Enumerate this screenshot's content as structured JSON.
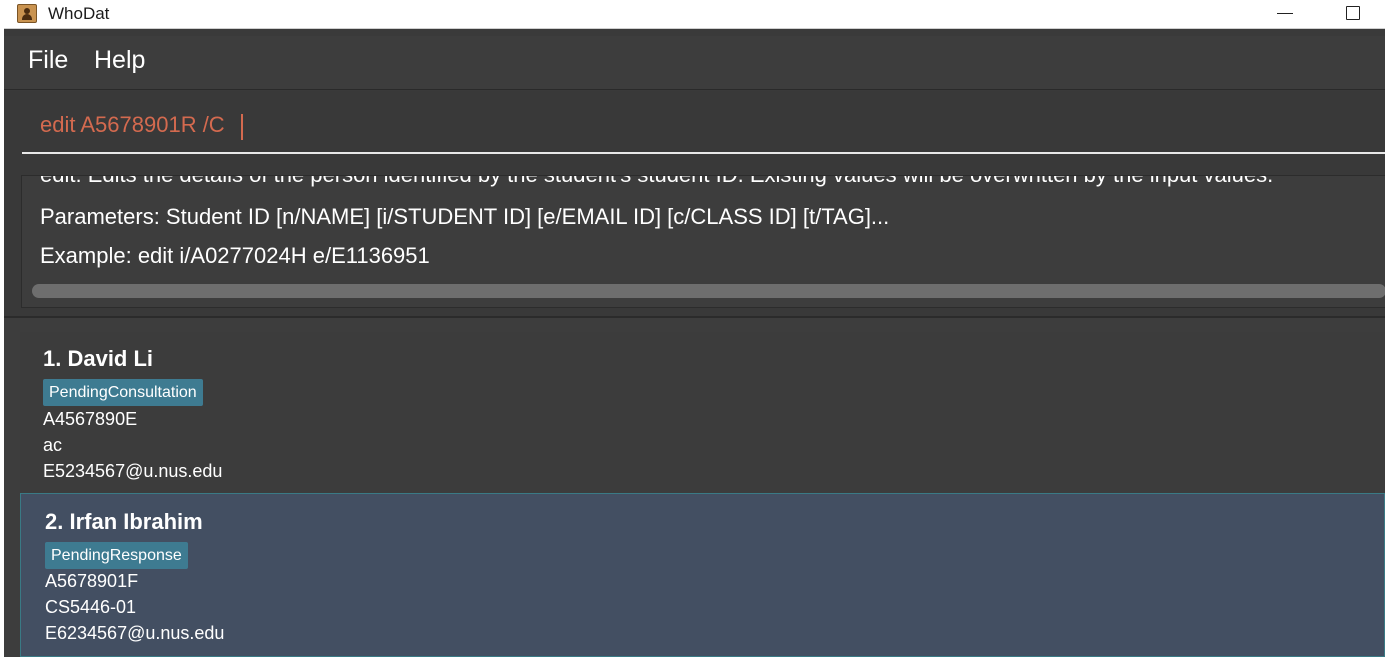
{
  "window": {
    "title": "WhoDat",
    "icon": "address-book-icon"
  },
  "menu": {
    "items": [
      "File",
      "Help"
    ]
  },
  "command_box": {
    "value": "edit A5678901R /C"
  },
  "result_display": {
    "lines": [
      "edit: Edits the details of the person identified by the student's student ID. Existing values will be overwritten by the input values.",
      "Parameters: Student ID [n/NAME] [i/STUDENT ID] [e/EMAIL ID] [c/CLASS ID] [t/TAG]...",
      "Example: edit i/A0277024H e/E1136951"
    ]
  },
  "persons": [
    {
      "name": "1. David Li",
      "tag": "PendingConsultation",
      "student_id": "A4567890E",
      "class_id": "ac",
      "email": "E5234567@u.nus.edu"
    },
    {
      "name": "2. Irfan Ibrahim",
      "tag": "PendingResponse",
      "student_id": "A5678901F",
      "class_id": "CS5446-01",
      "email": "E6234567@u.nus.edu"
    }
  ],
  "colors": {
    "background": "#3a3a3a",
    "command_text": "#d46a4f",
    "tag_background": "#3e7b91",
    "selected_card": "#434f62"
  }
}
